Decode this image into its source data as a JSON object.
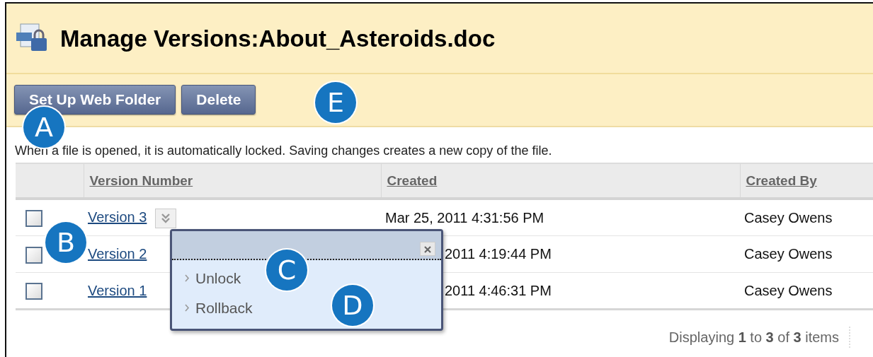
{
  "page": {
    "title": "Manage Versions:About_Asteroids.doc"
  },
  "toolbar": {
    "buttons": [
      "Set Up Web Folder",
      "Delete"
    ]
  },
  "instructions": "When a file is opened, it is automatically locked. Saving changes creates a new copy of the file.",
  "table": {
    "columns": [
      "Version Number",
      "Created",
      "Created By"
    ],
    "rows": [
      {
        "version": "Version 3",
        "created": "Mar 25, 2011 4:31:56 PM",
        "created_by": "Casey Owens",
        "checked": false,
        "menu_button": true
      },
      {
        "version": "Version 2",
        "created": "2011 4:19:44 PM",
        "created_by": "Casey Owens",
        "checked": false,
        "menu_button": false
      },
      {
        "version": "Version 1",
        "created": "2011 4:46:31 PM",
        "created_by": "Casey Owens",
        "checked": false,
        "menu_button": false
      }
    ]
  },
  "popup_menu": {
    "items": [
      "Unlock",
      "Rollback"
    ]
  },
  "callouts": [
    "A",
    "B",
    "C",
    "D",
    "E"
  ],
  "footer": "Displaying **1** to **3** of **3** items"
}
